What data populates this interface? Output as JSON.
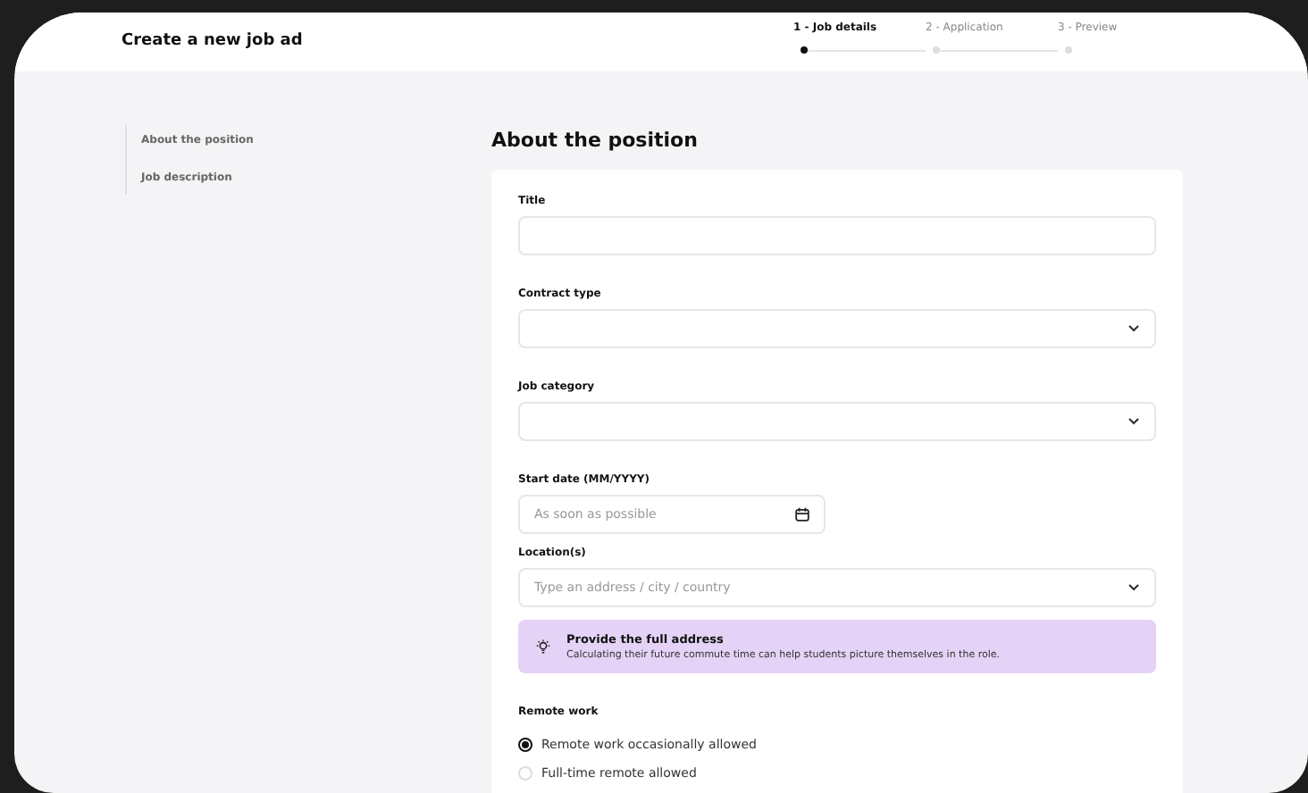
{
  "header": {
    "title": "Create a new job ad",
    "steps": [
      {
        "label": "1 - Job details",
        "selected": true
      },
      {
        "label": "2 - Application",
        "selected": false
      },
      {
        "label": "3 - Preview",
        "selected": false
      }
    ]
  },
  "sidebar": {
    "items": [
      {
        "label": "About the position"
      },
      {
        "label": "Job description"
      }
    ]
  },
  "section": {
    "heading": "About the position",
    "fields": [
      {
        "kind": "text",
        "label": "Title"
      },
      {
        "kind": "select",
        "label": "Contract type"
      },
      {
        "kind": "select",
        "label": "Job category"
      },
      {
        "kind": "date",
        "label": "Start date (MM/YYYY)",
        "placeholder": "As soon as possible"
      },
      {
        "kind": "select",
        "label": "Location(s)",
        "placeholder": "Type an address / city / country"
      }
    ],
    "callout": {
      "title": "Provide the full address",
      "text": "Calculating their future commute time can help students picture themselves in the role."
    },
    "remote_work": {
      "label": "Remote work",
      "options": [
        {
          "label": "Remote work occasionally allowed",
          "selected": true
        },
        {
          "label": "Full-time remote allowed",
          "selected": false
        }
      ]
    }
  }
}
